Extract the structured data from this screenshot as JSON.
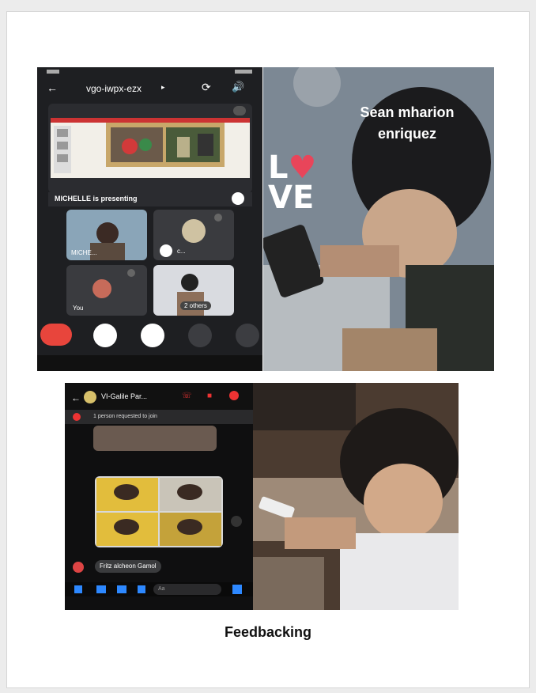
{
  "meet": {
    "meeting_code": "vgo-iwpx-ezx",
    "presenting_text": "MICHELLE is presenting",
    "tiles": [
      {
        "label": "MICHE..."
      },
      {
        "label": "c..."
      },
      {
        "label": "You"
      },
      {
        "label": "2 others"
      }
    ]
  },
  "photo1": {
    "overlay_name": "Sean mharion\nenriquez",
    "sticker_line1": "L",
    "sticker_line1b": "♥",
    "sticker_line2": "VE"
  },
  "messenger": {
    "chat_title": "VI-Galile Par...",
    "join_request": "1 person requested to join",
    "sender_name": "Fritz alcheon Gamol",
    "input_placeholder": "Aa"
  },
  "caption": "Feedbacking",
  "colors": {
    "end_call": "#e8453c",
    "meet_bg": "#1e1f22",
    "accent_blue": "#2d88ff"
  }
}
